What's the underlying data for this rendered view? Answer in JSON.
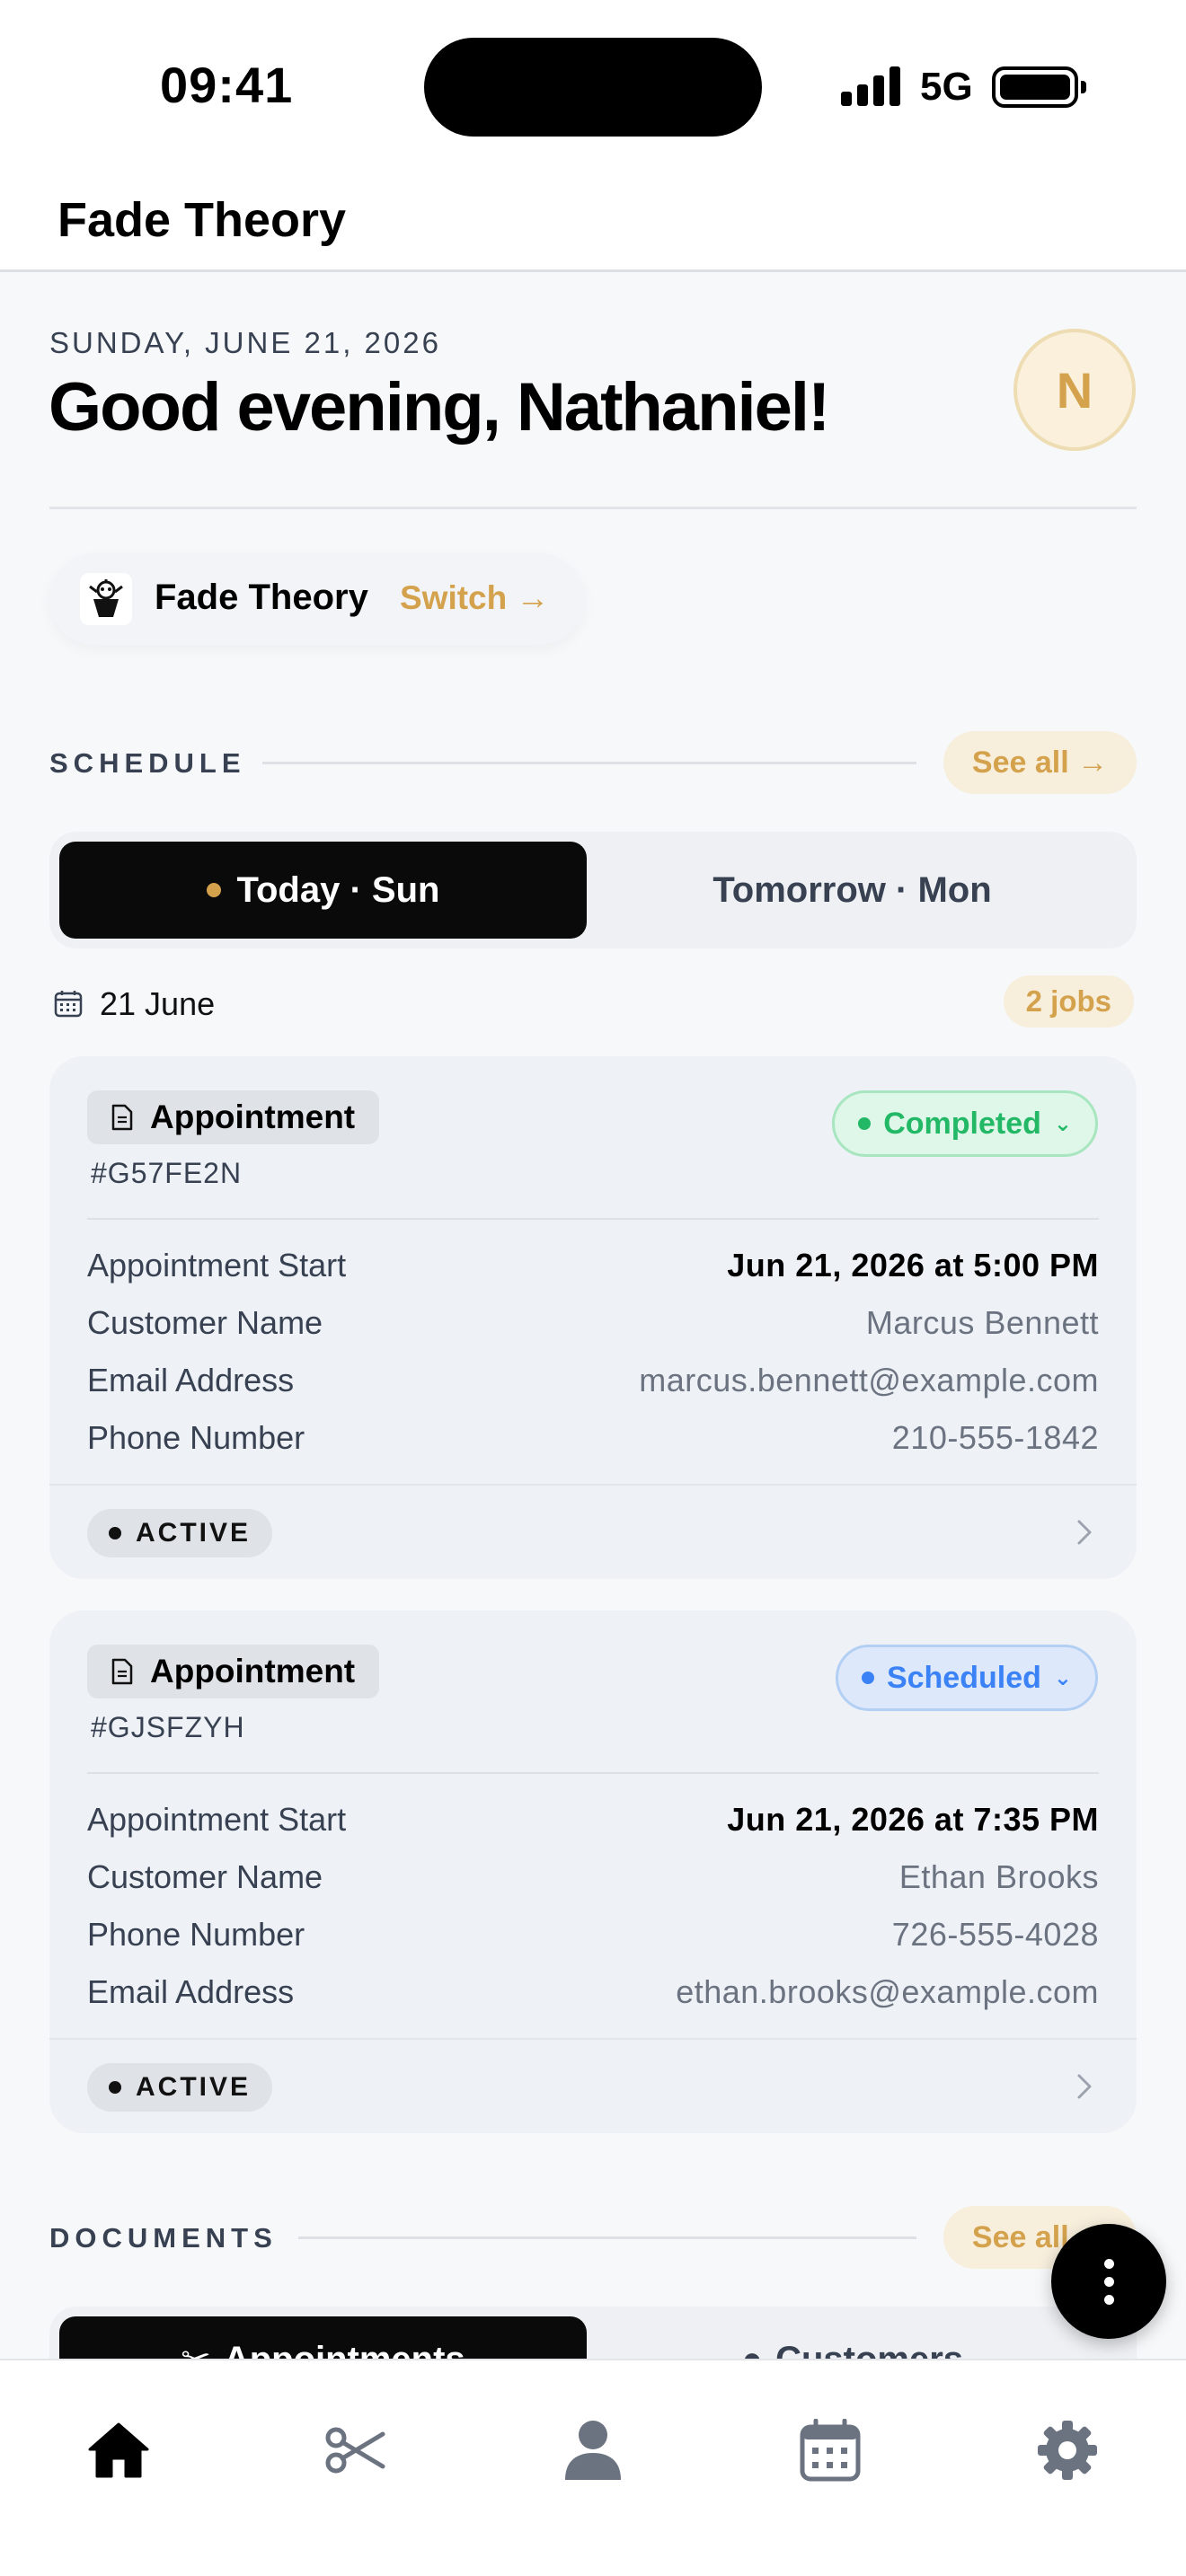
{
  "status_bar": {
    "time": "09:41",
    "network": "5G"
  },
  "app": {
    "title": "Fade Theory"
  },
  "greeting": {
    "date": "SUNDAY, JUNE 21, 2026",
    "message": "Good evening, Nathaniel!",
    "avatar_initial": "N"
  },
  "shop": {
    "name": "Fade Theory",
    "switch_label": "Switch →"
  },
  "schedule": {
    "section_label": "SCHEDULE",
    "see_all": "See all →",
    "tabs": [
      {
        "label": "Today · Sun",
        "active": true
      },
      {
        "label": "Tomorrow · Mon",
        "active": false
      }
    ],
    "day_label": "21 June",
    "jobs_count": "2 jobs",
    "appointments": [
      {
        "type": "Appointment",
        "id": "#G57FE2N",
        "status": "Completed",
        "rows": [
          {
            "label": "Appointment Start",
            "value": "Jun 21, 2026 at 5:00 PM"
          },
          {
            "label": "Customer Name",
            "value": "Marcus Bennett"
          },
          {
            "label": "Email Address",
            "value": "marcus.bennett@example.com"
          },
          {
            "label": "Phone Number",
            "value": "210-555-1842"
          }
        ],
        "badge": "ACTIVE"
      },
      {
        "type": "Appointment",
        "id": "#GJSFZYH",
        "status": "Scheduled",
        "rows": [
          {
            "label": "Appointment Start",
            "value": "Jun 21, 2026 at 7:35 PM"
          },
          {
            "label": "Customer Name",
            "value": "Ethan Brooks"
          },
          {
            "label": "Phone Number",
            "value": "726-555-4028"
          },
          {
            "label": "Email Address",
            "value": "ethan.brooks@example.com"
          }
        ],
        "badge": "ACTIVE"
      }
    ]
  },
  "documents": {
    "section_label": "DOCUMENTS",
    "see_all": "See all →",
    "tabs": [
      {
        "label": "Appointments",
        "icon": "scissors-icon",
        "active": true
      },
      {
        "label": "Customers",
        "icon": "person-icon",
        "active": false
      }
    ]
  },
  "tab_bar": {
    "items": [
      {
        "icon": "home-icon",
        "active": true
      },
      {
        "icon": "scissors-icon",
        "active": false
      },
      {
        "icon": "person-icon",
        "active": false
      },
      {
        "icon": "calendar-icon",
        "active": false
      },
      {
        "icon": "gear-icon",
        "active": false
      }
    ]
  },
  "colors": {
    "accent": "#d4a24c",
    "completed": "#22b866",
    "scheduled": "#3b82f6",
    "dark": "#0a0a0a"
  }
}
